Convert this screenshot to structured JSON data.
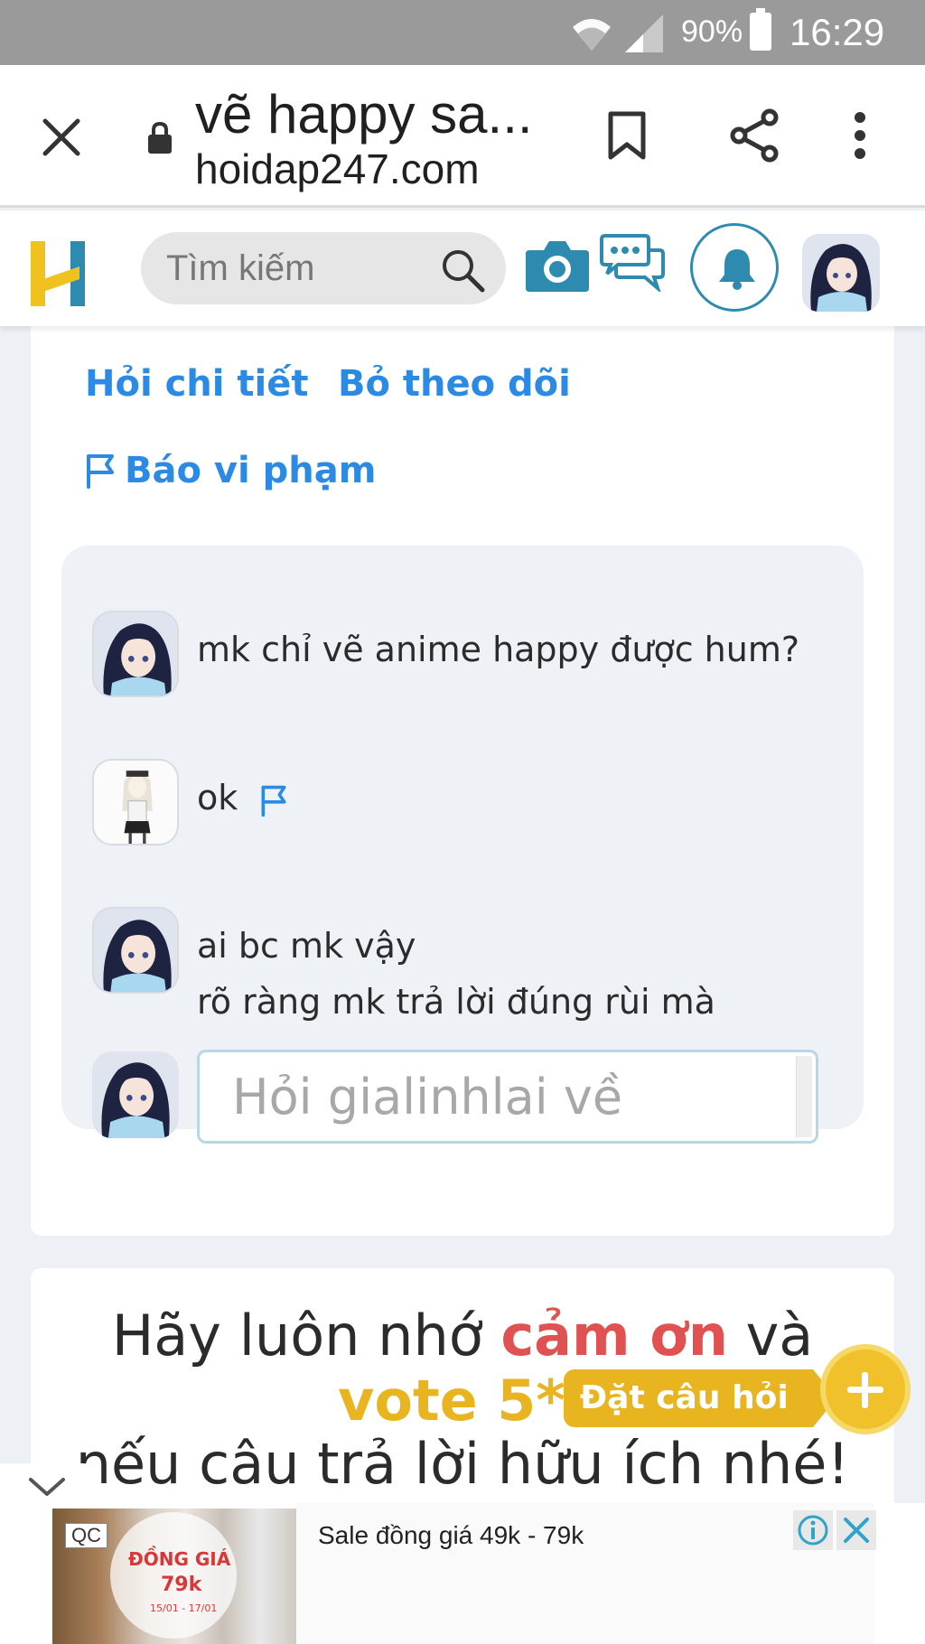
{
  "status_bar": {
    "battery": "90%",
    "time": "16:29"
  },
  "browser": {
    "title": "vẽ happy sa...",
    "domain": "hoidap247.com",
    "icons": [
      "close-icon",
      "lock-icon",
      "bookmark-icon",
      "share-icon",
      "more-icon"
    ]
  },
  "header": {
    "logo": "H",
    "search_placeholder": "Tìm kiếm",
    "icons": [
      "search-icon",
      "camera-icon",
      "chat-icon",
      "bell-icon"
    ],
    "colors": {
      "logo_yellow": "#efc21f",
      "logo_blue": "#2e8bb0",
      "accent": "#2a8ae4"
    }
  },
  "question_actions": {
    "ask_detail": "Hỏi chi tiết",
    "unfollow": "Bỏ theo dõi",
    "report": "Báo vi phạm"
  },
  "comments": [
    {
      "text": "mk chỉ vẽ anime happy được hum?"
    },
    {
      "text": "ok",
      "has_report_flag": true
    },
    {
      "text_line1": "ai bc mk vậy",
      "text_line2": "rõ ràng mk trả lời đúng rùi mà"
    }
  ],
  "reply": {
    "placeholder": "Hỏi gialinhlai về"
  },
  "thanks": {
    "line1_pre": "Hãy luôn nhớ ",
    "line1_highlight": "cảm ơn",
    "line1_post": " và",
    "line2": "vote 5*",
    "line3": "nếu câu trả lời hữu ích nhé!"
  },
  "ask_button": {
    "label": "Đặt câu hỏi"
  },
  "ad": {
    "badge": "QC",
    "image_line1": "ĐỒNG GIÁ",
    "image_line2": "79k",
    "image_line3": "15/01 - 17/01",
    "text": "Sale đồng giá 49k - 79k"
  }
}
